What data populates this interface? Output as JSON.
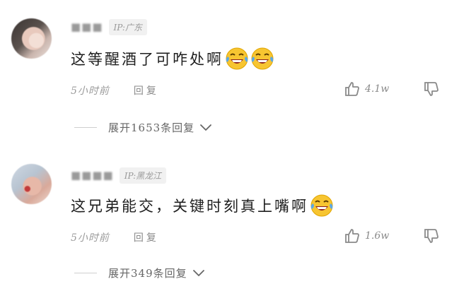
{
  "comments": [
    {
      "ip_location": "IP:广东",
      "text": "这等醒酒了可咋处啊",
      "emoji_count": 2,
      "time": "5小时前",
      "reply_label": "回复",
      "likes": "4.1w",
      "expand_label": "展开1653条回复"
    },
    {
      "ip_location": "IP:黑龙江",
      "text": "这兄弟能交，关键时刻真上嘴啊",
      "emoji_count": 1,
      "time": "5小时前",
      "reply_label": "回复",
      "likes": "1.6w",
      "expand_label": "展开349条回复"
    }
  ],
  "icons": {
    "emoji": "laughing-crying-emoji-icon",
    "like": "thumbs-up-icon",
    "dislike": "thumbs-down-icon",
    "expand": "chevron-down-icon"
  },
  "colors": {
    "emoji_face": "#f7c531",
    "tears": "#5aa8e8",
    "muted_text": "#9a9a9a"
  }
}
